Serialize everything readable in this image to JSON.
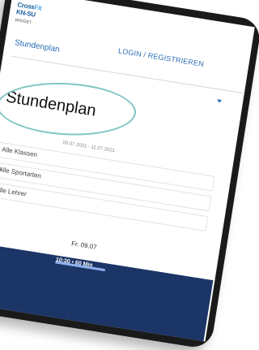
{
  "logo": {
    "line1a": "Cross",
    "line1b": "Fit",
    "line2a": "KN",
    "line2b": "-SU",
    "widget": "WIDGET"
  },
  "header": {
    "login": "LOGIN / REGISTRIEREN",
    "tab": "Stundenplan"
  },
  "page": {
    "title": "Stundenplan"
  },
  "nav": {
    "prev": "‹",
    "range": "05.07.2021 - 11.07.2021"
  },
  "filters": [
    {
      "label": "Alle Klassen"
    },
    {
      "label": "Alle Sportarten"
    },
    {
      "label": "Alle Lehrer"
    }
  ],
  "schedule": {
    "day": "Fr. 09.07",
    "time": "10:30 • 60 Min"
  }
}
